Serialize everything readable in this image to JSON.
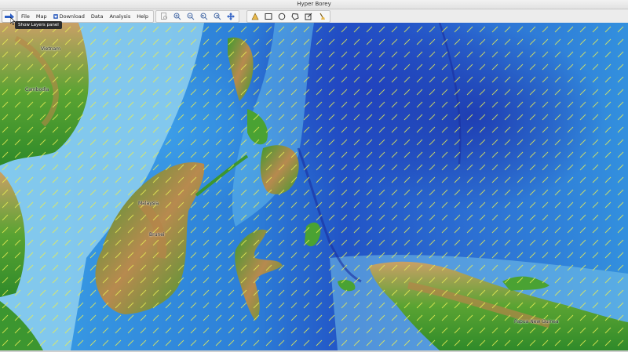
{
  "window": {
    "title": "Hyper Borey"
  },
  "toolbar": {
    "layers_tooltip": "Show Layers panel",
    "menu": [
      {
        "label": "File"
      },
      {
        "label": "Map"
      },
      {
        "label": "Download"
      },
      {
        "label": "Data"
      },
      {
        "label": "Analysis"
      },
      {
        "label": "Help"
      }
    ]
  },
  "map": {
    "places": [
      {
        "label": "Vietnam"
      },
      {
        "label": "Cambodia"
      },
      {
        "label": "Malaysia"
      },
      {
        "label": "Brunei"
      },
      {
        "label": "Papua New Guinea"
      }
    ]
  }
}
